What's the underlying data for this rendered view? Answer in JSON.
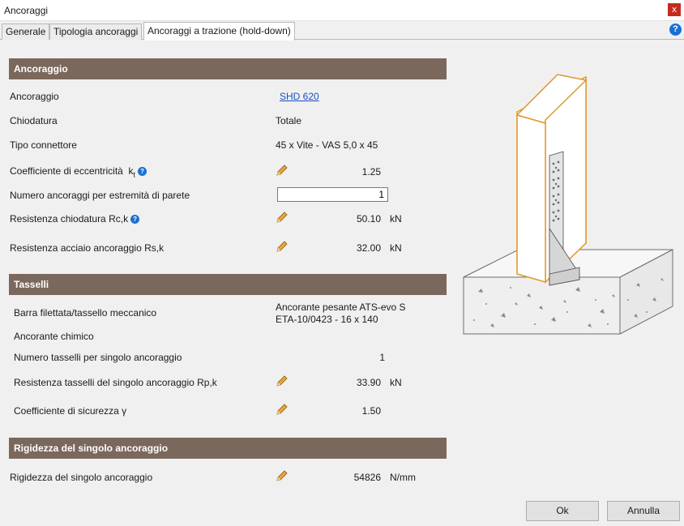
{
  "window": {
    "title": "Ancoraggi",
    "close_glyph": "x"
  },
  "tabs": [
    {
      "label": "Generale",
      "active": false
    },
    {
      "label": "Tipologia ancoraggi",
      "active": false
    },
    {
      "label": "Ancoraggi a trazione (hold-down)",
      "active": true
    }
  ],
  "help_glyph": "?",
  "sections": {
    "ancoraggio": {
      "title": "Ancoraggio",
      "rows": {
        "ancoraggio": {
          "label": "Ancoraggio",
          "value": "SHD 620"
        },
        "chiodatura": {
          "label": "Chiodatura",
          "value": "Totale"
        },
        "tipo_connettore": {
          "label": "Tipo connettore",
          "value": "45 x Vite - VAS 5,0 x 45"
        },
        "coeff_eccentricita": {
          "label": "Coefficiente di eccentricità",
          "symbol": "k",
          "symbol_sub": "t",
          "value": "1.25"
        },
        "numero_ancoraggi": {
          "label": "Numero ancoraggi per estremità di parete",
          "value": "1"
        },
        "resistenza_chiodatura": {
          "label": "Resistenza chiodatura Rc,k",
          "value": "50.10",
          "unit": "kN"
        },
        "resistenza_acciaio": {
          "label": "Resistenza acciaio ancoraggio Rs,k",
          "value": "32.00",
          "unit": "kN"
        }
      }
    },
    "tasselli": {
      "title": "Tasselli",
      "rows": {
        "barra": {
          "label": "Barra filettata/tassello meccanico",
          "value_line1": "Ancorante pesante ATS-evo S",
          "value_line2": "ETA-10/0423 - 16 x 140"
        },
        "chimico": {
          "label": "Ancorante chimico"
        },
        "numero_tasselli": {
          "label": "Numero tasselli per singolo ancoraggio",
          "value": "1"
        },
        "resistenza_tasselli": {
          "label": "Resistenza tasselli del singolo ancoraggio Rp,k",
          "value": "33.90",
          "unit": "kN"
        },
        "coeff_sicurezza": {
          "label": "Coefficiente di sicurezza γ",
          "value": "1.50"
        }
      }
    },
    "rigidezza": {
      "title": "Rigidezza del singolo ancoraggio",
      "rows": {
        "rigidezza": {
          "label": "Rigidezza del singolo ancoraggio",
          "value": "54826",
          "unit": "N/mm"
        }
      }
    }
  },
  "buttons": {
    "ok": "Ok",
    "cancel": "Annulla"
  },
  "colors": {
    "section_header": "#7b685c",
    "wood_outline": "#e09a2c",
    "link": "#1a4fc4",
    "accent_blue": "#1a6fd4"
  },
  "icons": {
    "edit": "pencil-icon",
    "info": "question-circle-icon",
    "close": "close-icon",
    "help": "help-icon"
  }
}
